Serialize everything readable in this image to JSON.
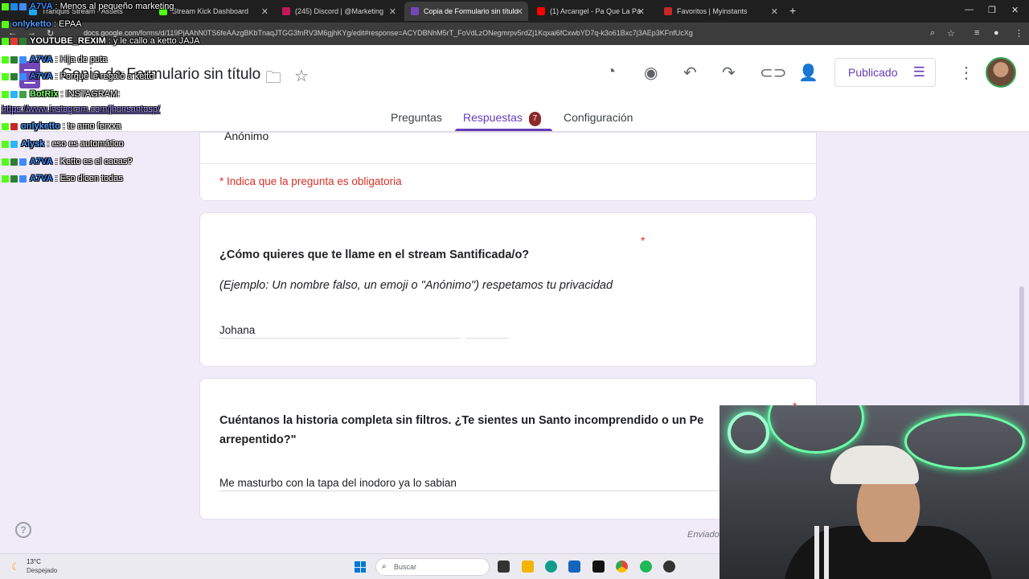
{
  "browser": {
    "tabs": [
      {
        "label": "Tranquis Stream - Assets",
        "color": "#1ba8f0"
      },
      {
        "label": "Stream Kick Dashboard",
        "color": "#53fc18"
      },
      {
        "label": "(245) Discord | @Marketing",
        "color": "#c2185b"
      },
      {
        "label": "Copia de Formulario sin título",
        "color": "#7248b9"
      },
      {
        "label": "(1) Arcangel - Pa Que La Pa",
        "color": "#ff0000"
      },
      {
        "label": "Favoritos | Myinstants",
        "color": "#c62828"
      }
    ],
    "url_host": "docs.google.com",
    "url_path": "/forms/d/119PjAAhN0TS6feAAzgBKbTnaqJTGG3fnRV3M6gjhKYg/edit#response=ACYDBNhM5rT_FoVdLzONegmrpv5rdZj1Kqxai6fCxwbYD7q-k3o61Bxc7j3AEp3KFnfUcXg"
  },
  "forms": {
    "doc_title": "Copia de Formulario sin título",
    "publish_label": "Publicado",
    "tabs": {
      "questions": "Preguntas",
      "responses": "Respuestas",
      "responses_count": "7",
      "settings": "Configuración"
    },
    "top_answer": "Anónimo",
    "required_note": "* Indica que la pregunta es obligatoria",
    "q1": {
      "title": "¿Cómo quieres que te llame en el stream Santificada/o?",
      "star": "*",
      "description": "(Ejemplo: Un nombre falso, un emoji o \"Anónimo\") respetamos tu privacidad",
      "answer": "Johana"
    },
    "q2": {
      "title_line1": "Cuéntanos la historia completa sin filtros. ¿Te sientes un Santo incomprendido o un Pe",
      "title_line2": "arrepentido?\"",
      "star": "*",
      "answer": "Me masturbo con la tapa del inodoro ya lo sabian"
    },
    "sent_label": "Enviado",
    "help_label": "?"
  },
  "chat": [
    {
      "user": "A7VA",
      "user_color": "#3d8bff",
      "msg": ": Menos al pequeño marketing",
      "icons": [
        "#53fc18",
        "#1e88e5",
        "#3d8bff"
      ]
    },
    {
      "user": "onlyketto",
      "user_color": "#4f9dff",
      "msg": ": EPAA",
      "icons": [
        "#53fc18"
      ]
    },
    {
      "user": "YOUTUBE_REXIM",
      "user_color": "#ffffff",
      "msg": ": y le callo a ketto JAJA",
      "icons": [
        "#53fc18",
        "#e53935",
        "#2e7d32"
      ]
    },
    {
      "user": "A7VA",
      "user_color": "#3d8bff",
      "msg": ": Hija de puta",
      "icons": [
        "#53fc18",
        "#2e7d32",
        "#3d8bff"
      ]
    },
    {
      "user": "A7VA",
      "user_color": "#3d8bff",
      "msg": ": Porque le regaló a ketto",
      "icons": [
        "#53fc18",
        "#2e7d32",
        "#3d8bff"
      ]
    },
    {
      "user": "BotRix",
      "user_color": "#7cff6b",
      "msg": ": INSTAGRAM:",
      "icons": [
        "#53fc18",
        "#29b6f6",
        "#43a047"
      ]
    },
    {
      "user": "",
      "user_color": "#ffffff",
      "msg": "https://www.instagram.com/jhonsantosp/",
      "icons": [],
      "link": true
    },
    {
      "user": "onlyketto",
      "user_color": "#4f9dff",
      "msg": ": te amo ferxxa",
      "icons": [
        "#53fc18",
        "#c62828"
      ]
    },
    {
      "user": "Alysk",
      "user_color": "#4f9dff",
      "msg": ": eso es automático",
      "icons": [
        "#53fc18",
        "#29b6f6"
      ]
    },
    {
      "user": "A7VA",
      "user_color": "#3d8bff",
      "msg": ": Ketto es el cacas?",
      "icons": [
        "#53fc18",
        "#2e7d32",
        "#3d8bff"
      ]
    },
    {
      "user": "A7VA",
      "user_color": "#3d8bff",
      "msg": ": Eso dicen todas",
      "icons": [
        "#53fc18",
        "#2e7d32",
        "#3d8bff"
      ]
    }
  ],
  "taskbar": {
    "weather_temp": "13°C",
    "weather_desc": "Despejado",
    "search_placeholder": "Buscar"
  },
  "colors": {
    "accent": "#673ab7",
    "required": "#d93025",
    "page_bg": "#f0ebf8"
  }
}
